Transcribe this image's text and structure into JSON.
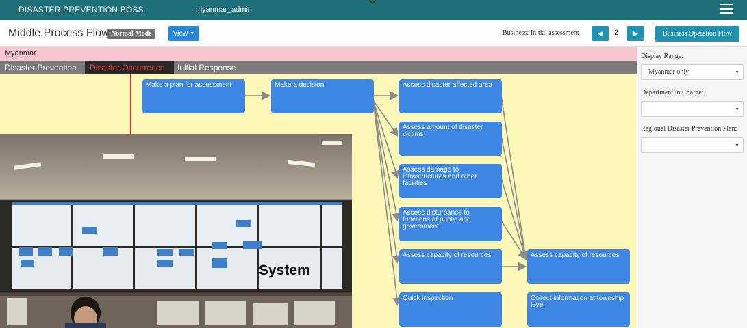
{
  "app": {
    "title": "DISASTER PREVENTION BOSS",
    "user": "myanmar_admin"
  },
  "toolbar": {
    "page_title": "Middle Process Flow",
    "mode_badge": "Normal Mode",
    "view_label": "View",
    "business_label": "Business: Initial assessment",
    "page_number": "2",
    "operation_flow_label": "Business Operation Flow"
  },
  "region": {
    "label": "Myanmar"
  },
  "phases": [
    {
      "label": "Disaster Prevention",
      "active": false
    },
    {
      "label": "Disaster Occurrence",
      "active": true
    },
    {
      "label": "Initial Response",
      "active": false
    }
  ],
  "nodes": [
    {
      "id": "n1",
      "label": "Make a plan for assessment"
    },
    {
      "id": "n2",
      "label": "Make a decision"
    },
    {
      "id": "n3",
      "label": "Assess disaster affected area"
    },
    {
      "id": "n4",
      "label": "Assess amount of disaster victims"
    },
    {
      "id": "n5",
      "label": "Assess damage to infrastructures and other facilities"
    },
    {
      "id": "n6",
      "label": "Assess disturbance to functions of public and government"
    },
    {
      "id": "n7",
      "label": "Assess capacity of resources"
    },
    {
      "id": "n8",
      "label": "Quick inspection"
    },
    {
      "id": "n9",
      "label": "Assess capacity of resources"
    },
    {
      "id": "n10",
      "label": "Collect information at township level"
    }
  ],
  "side_panel": {
    "display_range_label": "Display Range:",
    "display_range_value": "Myanmar only",
    "department_label": "Department in Charge:",
    "department_value": "",
    "regional_plan_label": "Regional Disaster Prevention Plan:",
    "regional_plan_value": ""
  },
  "photo": {
    "caption": "System"
  },
  "colors": {
    "topbar": "#1f6f78",
    "node": "#3d86e4",
    "canvas": "#fdf8b8",
    "accent": "#2193b0",
    "active_phase": "#e53c3c"
  },
  "icons": [
    "hamburger-menu-icon",
    "chevron-left-icon",
    "chevron-right-icon",
    "caret-down-icon"
  ]
}
